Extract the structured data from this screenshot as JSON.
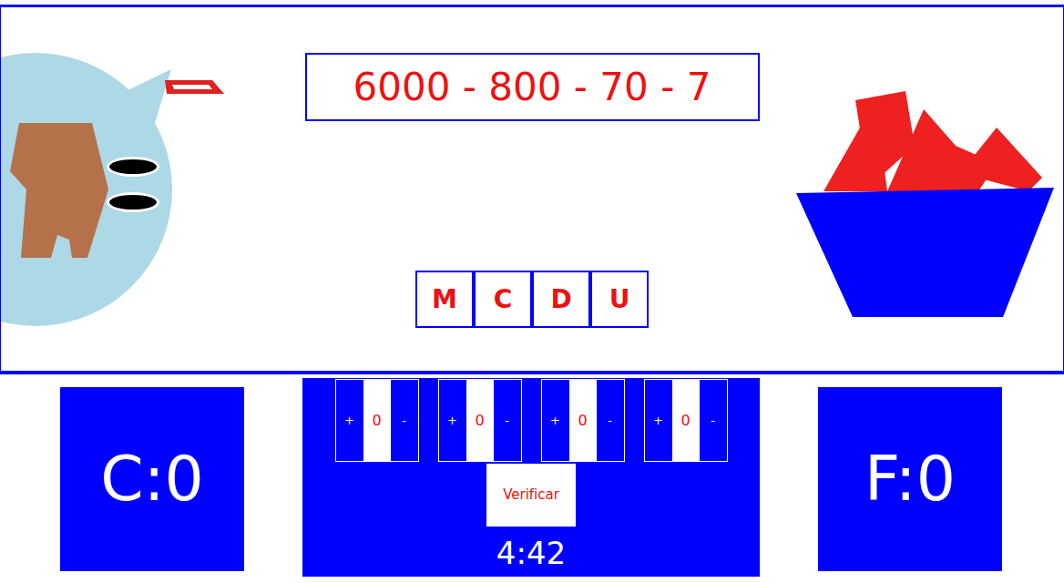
{
  "expression": "6000 - 800 - 70 - 7",
  "place_labels": [
    "M",
    "C",
    "D",
    "U"
  ],
  "scores": {
    "correct": "C:0",
    "failed": "F:0"
  },
  "spinners": [
    {
      "plus": "+",
      "value": "0",
      "minus": "-"
    },
    {
      "plus": "+",
      "value": "0",
      "minus": "-"
    },
    {
      "plus": "+",
      "value": "0",
      "minus": "-"
    },
    {
      "plus": "+",
      "value": "0",
      "minus": "-"
    }
  ],
  "verify_button": "Verificar",
  "timer": "4:42"
}
